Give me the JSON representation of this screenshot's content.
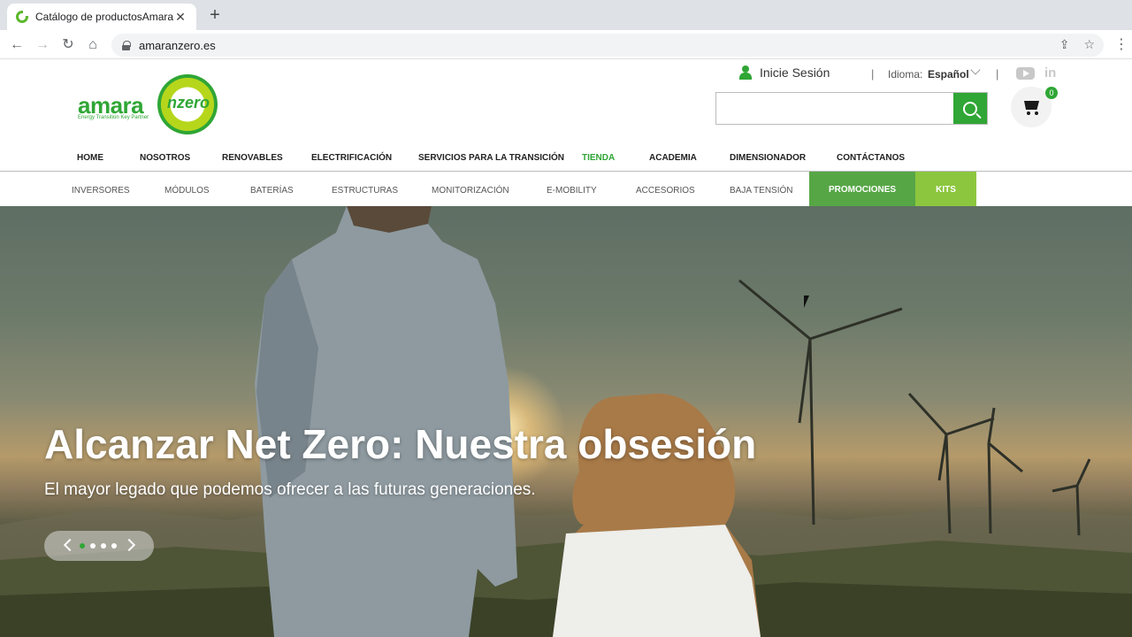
{
  "browser": {
    "tab_title": "Catálogo de productosAmara",
    "tab_close": "✕",
    "new_tab": "+",
    "url": "amaranzero.es",
    "back": "←",
    "forward": "→",
    "reload": "↻",
    "home": "⌂",
    "share": "⇪",
    "bookmark": "☆",
    "menu": "⋮"
  },
  "header": {
    "logo": {
      "brand": "amara",
      "ring": "nzero",
      "tagline": "Energy Transition Key Partner"
    },
    "login_label": "Inicie Sesión",
    "separator": "|",
    "language_label": "Idioma:",
    "language_value": "Español",
    "social_linkedin": "in",
    "search_placeholder": "",
    "cart_count": "0"
  },
  "main_nav": [
    {
      "label": "HOME",
      "active": false
    },
    {
      "label": "NOSOTROS",
      "active": false
    },
    {
      "label": "RENOVABLES",
      "active": false
    },
    {
      "label": "ELECTRIFICACIÓN",
      "active": false
    },
    {
      "label": "SERVICIOS PARA LA TRANSICIÓN",
      "active": false
    },
    {
      "label": "TIENDA",
      "active": true
    },
    {
      "label": "ACADEMIA",
      "active": false
    },
    {
      "label": "DIMENSIONADOR",
      "active": false
    },
    {
      "label": "CONTÁCTANOS",
      "active": false
    }
  ],
  "sub_nav": [
    {
      "label": "INVERSORES"
    },
    {
      "label": "MÓDULOS"
    },
    {
      "label": "BATERÍAS"
    },
    {
      "label": "ESTRUCTURAS"
    },
    {
      "label": "MONITORIZACIÓN"
    },
    {
      "label": "E-MOBILITY"
    },
    {
      "label": "ACCESORIOS"
    },
    {
      "label": "BAJA TENSIÓN"
    }
  ],
  "sub_nav_highlight": {
    "promotions": "PROMOCIONES",
    "kits": "KITS"
  },
  "colors": {
    "brand_green": "#2fa635",
    "promo_green": "#57a646",
    "kits_green": "#8cc63e"
  },
  "hero": {
    "title": "Alcanzar Net Zero: Nuestra obsesión",
    "subtitle": "El mayor legado que podemos ofrecer a las futuras generaciones.",
    "slides_total": 4,
    "active_slide": 1
  }
}
